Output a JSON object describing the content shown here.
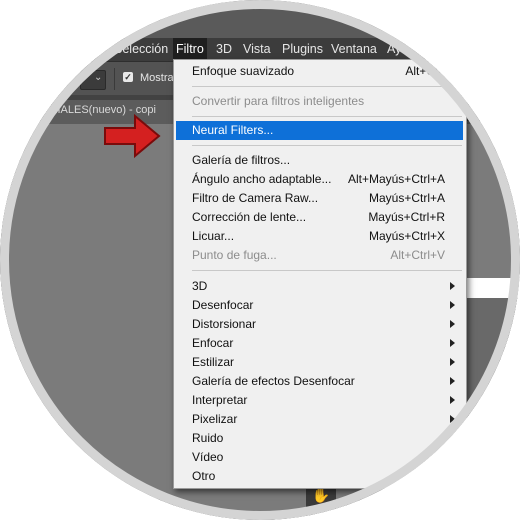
{
  "menubar": {
    "items": [
      "Selección",
      "Filtro",
      "3D",
      "Vista",
      "Plugins",
      "Ventana",
      "Ay"
    ],
    "active": "Filtro"
  },
  "options_bar": {
    "checkbox_label": "Mostrar",
    "checked": true
  },
  "document_tab": {
    "label": "ORIALES(nuevo) - copi"
  },
  "filter_menu": {
    "items": [
      {
        "label": "Enfoque suavizado",
        "shortcut": "Alt+Ctrl"
      },
      {
        "label": "Convertir para filtros inteligentes",
        "disabled": true
      },
      {
        "label": "Neural Filters...",
        "highlighted": true
      },
      {
        "label": "Galería de filtros..."
      },
      {
        "label": "Ángulo ancho adaptable...",
        "shortcut": "Alt+Mayús+Ctrl+A"
      },
      {
        "label": "Filtro de Camera Raw...",
        "shortcut": "Mayús+Ctrl+A"
      },
      {
        "label": "Corrección de lente...",
        "shortcut": "Mayús+Ctrl+R"
      },
      {
        "label": "Licuar...",
        "shortcut": "Mayús+Ctrl+X"
      },
      {
        "label": "Punto de fuga...",
        "shortcut": "Alt+Ctrl+V",
        "disabled": true
      },
      {
        "label": "3D",
        "submenu": true
      },
      {
        "label": "Desenfocar",
        "submenu": true
      },
      {
        "label": "Distorsionar",
        "submenu": true
      },
      {
        "label": "Enfocar",
        "submenu": true
      },
      {
        "label": "Estilizar",
        "submenu": true
      },
      {
        "label": "Galería de efectos Desenfocar",
        "submenu": true
      },
      {
        "label": "Interpretar",
        "submenu": true
      },
      {
        "label": "Pixelizar",
        "submenu": true
      },
      {
        "label": "Ruido"
      },
      {
        "label": "Vídeo"
      },
      {
        "label": "Otro"
      }
    ]
  },
  "colors": {
    "highlight": "#0e70d8",
    "arrow": "#d42020",
    "menu_bg": "#f0f0f0"
  },
  "icons": {
    "pointer": "red-arrow-icon",
    "hand": "hand-tool-icon"
  }
}
